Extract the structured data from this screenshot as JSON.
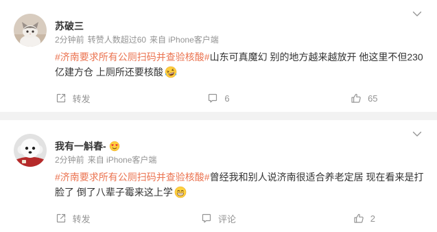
{
  "colors": {
    "hashtag": "#eb7350",
    "text": "#333333",
    "username": "#333333",
    "meta": "#939393",
    "icon": "#939393",
    "separator": "#f2f2f2",
    "card": "#ffffff"
  },
  "icons": {
    "menu": "chevron-down-icon",
    "repost": "share-icon",
    "comment": "comment-icon",
    "like": "thumbs-up-icon"
  },
  "feed": {
    "posts": [
      {
        "username": "苏破三",
        "meta": {
          "time": "2分钟前",
          "note": "转赞人数超过60",
          "source": "来自 iPhone客户端"
        },
        "content": {
          "hashtag": "#济南要求所有公厕扫码并查验核酸#",
          "text": "山东可真魔幻 别的地方越来越放开 他这里不但230亿建方仓 上厕所还要核酸",
          "emoji": "laughing-crying-emoji-icon"
        },
        "actions": {
          "repost": "转发",
          "comment": "6",
          "like": "65"
        }
      },
      {
        "username": "我有一斛春-",
        "username_badge": "heart-eyes-emoji-icon",
        "meta": {
          "time": "2分钟前",
          "source": "来自 iPhone客户端"
        },
        "content": {
          "hashtag": "#济南要求所有公厕扫码并查验核酸#",
          "text": "曾经我和别人说济南很适合养老定居 现在看来是打脸了 倒了八辈子霉来这上学",
          "emoji": "grinning-emoji-icon"
        },
        "actions": {
          "repost": "转发",
          "comment": "评论",
          "like": "2"
        }
      }
    ]
  }
}
